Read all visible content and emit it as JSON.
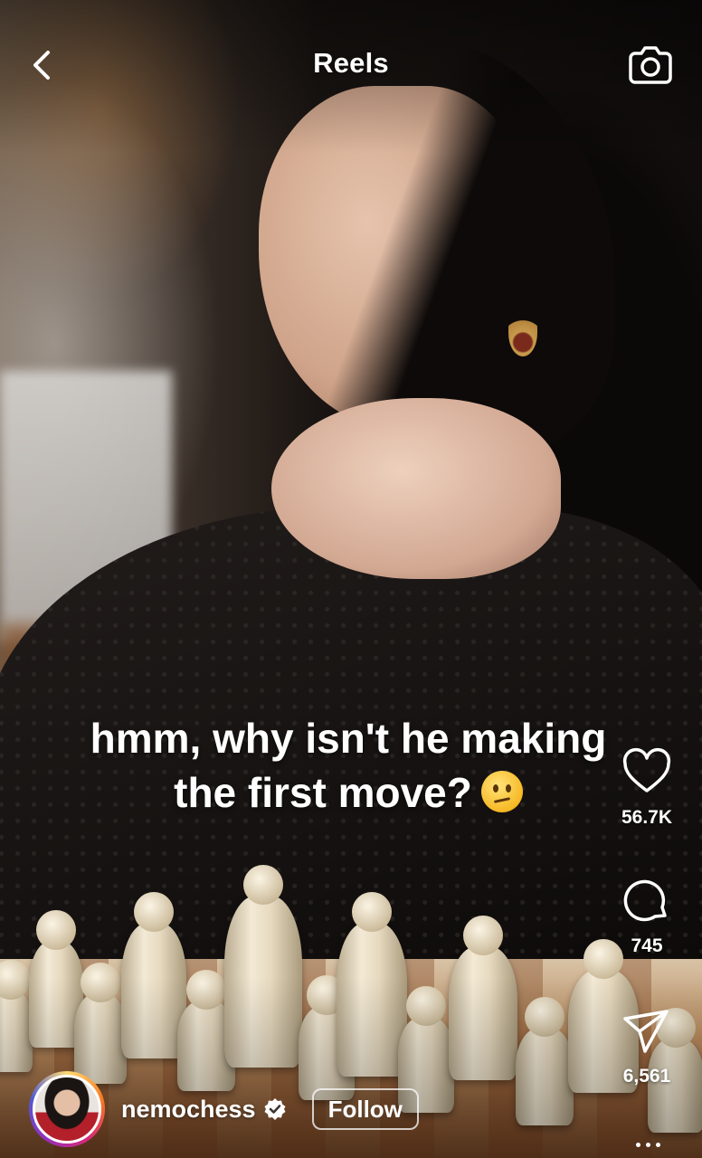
{
  "header": {
    "title": "Reels"
  },
  "icons": {
    "back": "chevron-left-icon",
    "camera": "camera-icon",
    "like": "heart-icon",
    "comment": "comment-bubble-icon",
    "share": "paper-plane-icon",
    "more": "more-dots-icon",
    "verified": "verified-badge-icon"
  },
  "caption": {
    "line1": "hmm, why isn't he making",
    "line2": "the first move?",
    "emoji": "confused-face-emoji"
  },
  "actions": {
    "likes": "56.7K",
    "comments": "745",
    "shares": "6,561"
  },
  "author": {
    "username": "nemochess",
    "verified": true,
    "follow_label": "Follow"
  },
  "colors": {
    "text": "#ffffff",
    "story_ring": [
      "#feda75",
      "#fa7e1e",
      "#d62976",
      "#962fbf",
      "#4f5bd5"
    ]
  }
}
